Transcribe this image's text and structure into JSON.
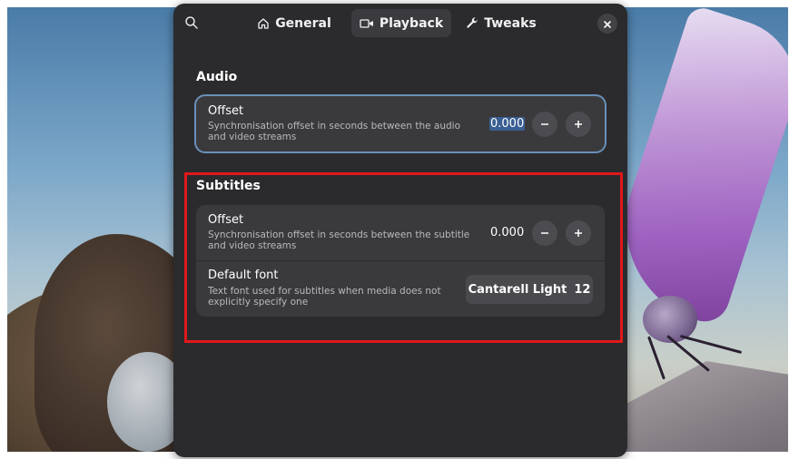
{
  "header": {
    "tabs": [
      {
        "label": "General",
        "icon": "home-icon"
      },
      {
        "label": "Playback",
        "icon": "video-camera-icon"
      },
      {
        "label": "Tweaks",
        "icon": "wrench-icon"
      }
    ],
    "active_tab": "Playback"
  },
  "audio": {
    "title": "Audio",
    "offset": {
      "title": "Offset",
      "subtitle": "Synchronisation offset in seconds between the audio and video streams",
      "value": "0.000"
    }
  },
  "subtitles": {
    "title": "Subtitles",
    "offset": {
      "title": "Offset",
      "subtitle": "Synchronisation offset in seconds between the subtitle and video streams",
      "value": "0.000"
    },
    "default_font": {
      "title": "Default font",
      "subtitle": "Text font used for subtitles when media does not explicitly specify one",
      "font_name": "Cantarell Light",
      "font_size": "12"
    }
  },
  "colors": {
    "dialog_bg": "#2b2b2e",
    "card_bg": "#3a3a3d",
    "highlight": "#e0181b",
    "selection": "#3a5f93"
  }
}
